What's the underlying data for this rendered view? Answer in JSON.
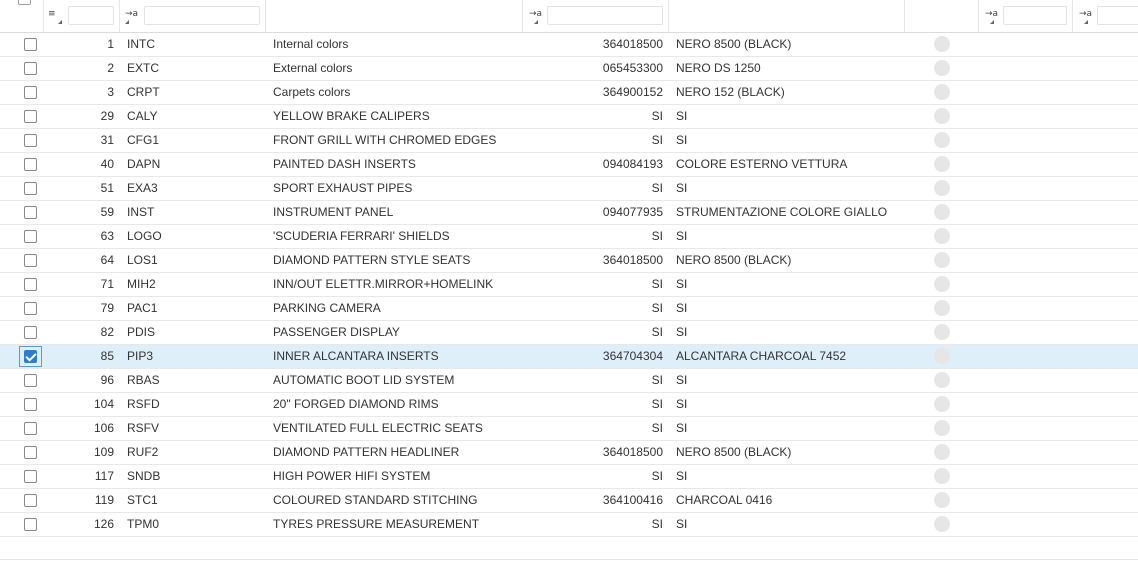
{
  "filters": {
    "number_placeholder": "",
    "code_placeholder": "",
    "value_placeholder": "",
    "extra1_placeholder": "",
    "extra2_placeholder": "",
    "icon_number": "list-filter-icon",
    "icon_text": "text-filter-icon",
    "text_filter_glyph": "→a",
    "number_filter_glyph": "≡"
  },
  "colors": {
    "selected_row": "#dfeffa",
    "checkbox_checked": "#2d7ec9",
    "status_dot": "#e6e6e6"
  },
  "rows": [
    {
      "checked": false,
      "num": "1",
      "code": "INTC",
      "desc": "Internal colors",
      "value": "364018500",
      "value_desc": "NERO 8500 (BLACK)"
    },
    {
      "checked": false,
      "num": "2",
      "code": "EXTC",
      "desc": "External colors",
      "value": "065453300",
      "value_desc": "NERO DS 1250"
    },
    {
      "checked": false,
      "num": "3",
      "code": "CRPT",
      "desc": "Carpets colors",
      "value": "364900152",
      "value_desc": "NERO 152 (BLACK)"
    },
    {
      "checked": false,
      "num": "29",
      "code": "CALY",
      "desc": "YELLOW BRAKE CALIPERS",
      "value": "SI",
      "value_desc": "SI"
    },
    {
      "checked": false,
      "num": "31",
      "code": "CFG1",
      "desc": "FRONT GRILL WITH CHROMED EDGES",
      "value": "SI",
      "value_desc": "SI"
    },
    {
      "checked": false,
      "num": "40",
      "code": "DAPN",
      "desc": "PAINTED DASH INSERTS",
      "value": "094084193",
      "value_desc": "COLORE ESTERNO VETTURA"
    },
    {
      "checked": false,
      "num": "51",
      "code": "EXA3",
      "desc": "SPORT EXHAUST PIPES",
      "value": "SI",
      "value_desc": "SI"
    },
    {
      "checked": false,
      "num": "59",
      "code": "INST",
      "desc": "INSTRUMENT PANEL",
      "value": "094077935",
      "value_desc": "STRUMENTAZIONE COLORE GIALLO"
    },
    {
      "checked": false,
      "num": "63",
      "code": "LOGO",
      "desc": "'SCUDERIA FERRARI' SHIELDS",
      "value": "SI",
      "value_desc": "SI"
    },
    {
      "checked": false,
      "num": "64",
      "code": "LOS1",
      "desc": "DIAMOND PATTERN STYLE SEATS",
      "value": "364018500",
      "value_desc": "NERO 8500 (BLACK)"
    },
    {
      "checked": false,
      "num": "71",
      "code": "MIH2",
      "desc": "INN/OUT ELETTR.MIRROR+HOMELINK",
      "value": "SI",
      "value_desc": "SI"
    },
    {
      "checked": false,
      "num": "79",
      "code": "PAC1",
      "desc": "PARKING CAMERA",
      "value": "SI",
      "value_desc": "SI"
    },
    {
      "checked": false,
      "num": "82",
      "code": "PDIS",
      "desc": "PASSENGER DISPLAY",
      "value": "SI",
      "value_desc": "SI"
    },
    {
      "checked": true,
      "num": "85",
      "code": "PIP3",
      "desc": "INNER ALCANTARA INSERTS",
      "value": "364704304",
      "value_desc": "ALCANTARA CHARCOAL 7452"
    },
    {
      "checked": false,
      "num": "96",
      "code": "RBAS",
      "desc": "AUTOMATIC BOOT LID SYSTEM",
      "value": "SI",
      "value_desc": "SI"
    },
    {
      "checked": false,
      "num": "104",
      "code": "RSFD",
      "desc": "20\" FORGED DIAMOND RIMS",
      "value": "SI",
      "value_desc": "SI"
    },
    {
      "checked": false,
      "num": "106",
      "code": "RSFV",
      "desc": "VENTILATED FULL ELECTRIC SEATS",
      "value": "SI",
      "value_desc": "SI"
    },
    {
      "checked": false,
      "num": "109",
      "code": "RUF2",
      "desc": "DIAMOND PATTERN HEADLINER",
      "value": "364018500",
      "value_desc": "NERO 8500 (BLACK)"
    },
    {
      "checked": false,
      "num": "117",
      "code": "SNDB",
      "desc": "HIGH POWER HIFI SYSTEM",
      "value": "SI",
      "value_desc": "SI"
    },
    {
      "checked": false,
      "num": "119",
      "code": "STC1",
      "desc": "COLOURED STANDARD STITCHING",
      "value": "364100416",
      "value_desc": "CHARCOAL 0416"
    },
    {
      "checked": false,
      "num": "126",
      "code": "TPM0",
      "desc": "TYRES PRESSURE MEASUREMENT",
      "value": "SI",
      "value_desc": "SI"
    }
  ]
}
